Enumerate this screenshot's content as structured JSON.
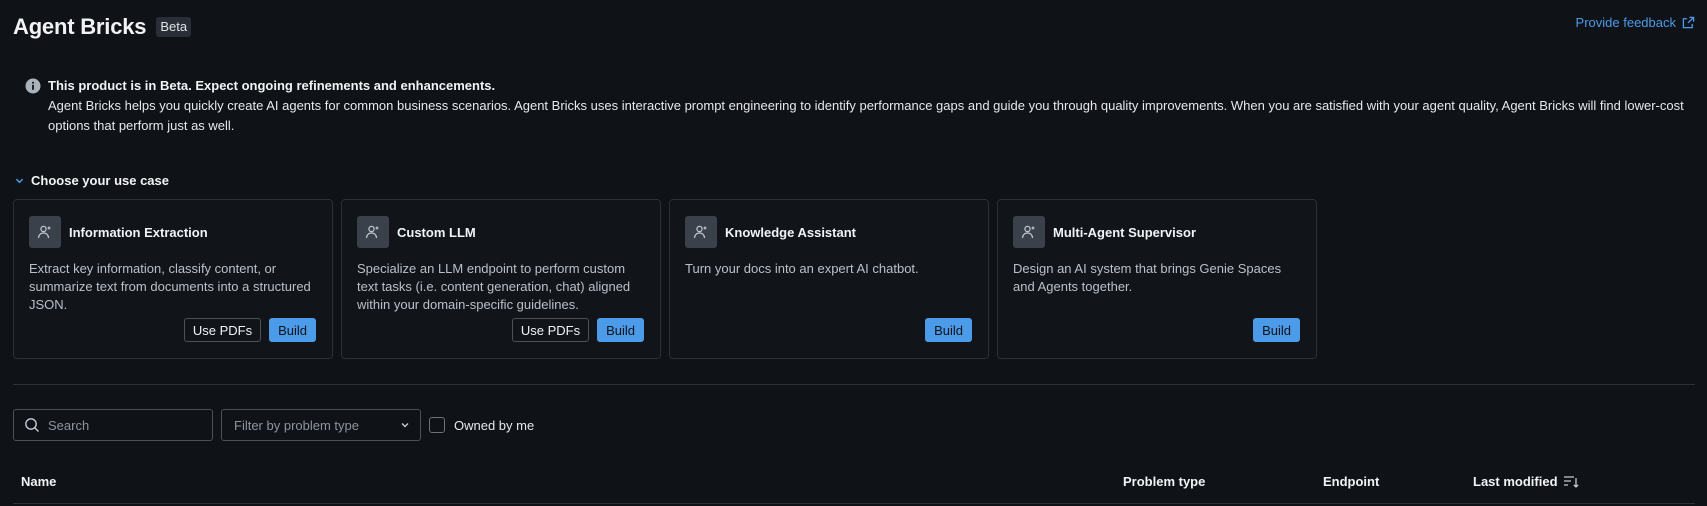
{
  "header": {
    "title": "Agent Bricks",
    "badge": "Beta",
    "feedback_label": "Provide feedback"
  },
  "banner": {
    "title": "This product is in Beta. Expect ongoing refinements and enhancements.",
    "text": "Agent Bricks helps you quickly create AI agents for common business scenarios. Agent Bricks uses interactive prompt engineering to identify performance gaps and guide you through quality improvements. When you are satisfied with your agent quality, Agent Bricks will find lower-cost options that perform just as well."
  },
  "use_cases": {
    "section_label": "Choose your use case",
    "cards": [
      {
        "title": "Information Extraction",
        "description": "Extract key information, classify content, or summarize text from documents into a structured JSON.",
        "secondary_label": "Use PDFs",
        "primary_label": "Build"
      },
      {
        "title": "Custom LLM",
        "description": "Specialize an LLM endpoint to perform custom text tasks (i.e. content generation, chat) aligned within your domain-specific guidelines.",
        "secondary_label": "Use PDFs",
        "primary_label": "Build"
      },
      {
        "title": "Knowledge Assistant",
        "description": "Turn your docs into an expert AI chatbot.",
        "primary_label": "Build"
      },
      {
        "title": "Multi-Agent Supervisor",
        "description": "Design an AI system that brings Genie Spaces and Agents together.",
        "primary_label": "Build"
      }
    ]
  },
  "filters": {
    "search_placeholder": "Search",
    "problem_type_placeholder": "Filter by problem type",
    "owned_label": "Owned by me"
  },
  "table": {
    "columns": [
      "Name",
      "Problem type",
      "Endpoint",
      "Last modified"
    ]
  },
  "colors": {
    "background": "#0f1217",
    "accent": "#4c9be8",
    "border": "#2b3038"
  }
}
